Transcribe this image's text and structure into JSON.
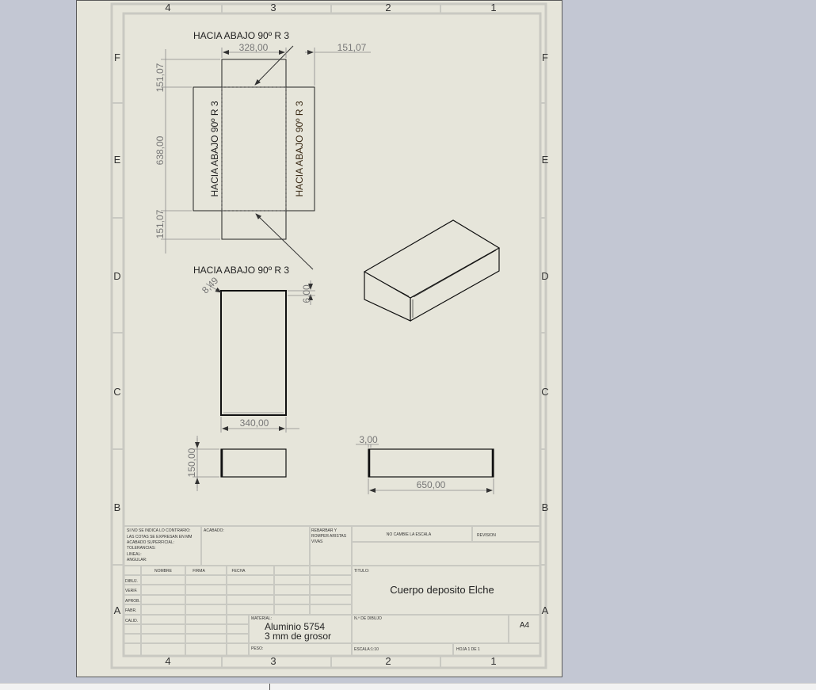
{
  "border": {
    "columns_top": [
      "4",
      "3",
      "2",
      "1"
    ],
    "columns_bottom": [
      "4",
      "3",
      "2",
      "1"
    ],
    "rows_left": [
      "F",
      "E",
      "D",
      "C",
      "B",
      "A"
    ],
    "rows_right": [
      "F",
      "E",
      "D",
      "C",
      "B",
      "A"
    ]
  },
  "flat_pattern": {
    "bend_note_top": "HACIA ABAJO  90º  R 3",
    "bend_note_left": "HACIA ABAJO  90º  R 3",
    "bend_note_right": "HACIA ABAJO  90º  R 3",
    "bend_note_bottom": "HACIA ABAJO  90º  R 3",
    "dim_width": "328,00",
    "dim_flange": "151,07",
    "dim_top_flange": "151,07",
    "dim_length": "638,00",
    "dim_bottom_flange": "151,07"
  },
  "front_view": {
    "dim_chamfer": "8,49",
    "dim_thickness": "6,00",
    "dim_width": "340,00"
  },
  "side_view": {
    "dim_height": "150,00"
  },
  "bottom_view": {
    "dim_thickness": "3,00",
    "dim_length": "650,00"
  },
  "title_block": {
    "notes_lines": [
      "SI NO SE INDICA LO CONTRARIO:",
      "LAS COTAS SE EXPRESAN EN MM",
      "ACABADO SUPERFICIAL:",
      "TOLERANCIAS:",
      "   LINEAL:",
      "   ANGULAR:"
    ],
    "acabado_label": "ACABADO:",
    "rebarbar_lines": [
      "REBARBAR Y",
      "ROMPER ARISTAS",
      "VIVAS"
    ],
    "no_cambie_escala": "NO CAMBIE LA ESCALA",
    "revision_label": "REVISION",
    "col_headers": [
      "NOMBRE",
      "FIRMA",
      "FECHA"
    ],
    "row_labels": [
      "DIBUJ.",
      "VERIF.",
      "APROB.",
      "FABR.",
      "CALID."
    ],
    "titulo_label": "TITULO:",
    "title": "Cuerpo deposito Elche",
    "material_label": "MATERIAL:",
    "material_line1": "Aluminio 5754",
    "material_line2": "3 mm de grosor",
    "n_dibujo_label": "N.º DE DIBUJO",
    "size": "A4",
    "peso_label": "PESO:",
    "escala": "ESCALA:1:10",
    "hoja": "HOJA 1 DE 1"
  }
}
